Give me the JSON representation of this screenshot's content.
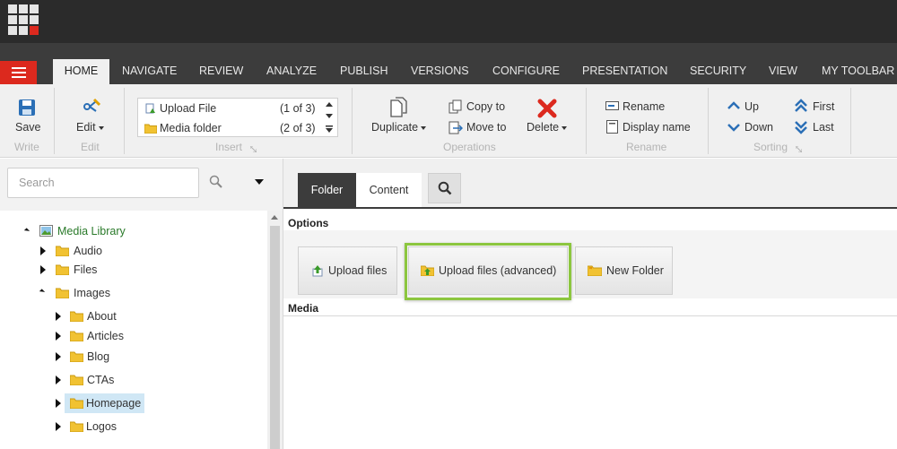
{
  "nav": {
    "tabs": [
      "HOME",
      "NAVIGATE",
      "REVIEW",
      "ANALYZE",
      "PUBLISH",
      "VERSIONS",
      "CONFIGURE",
      "PRESENTATION",
      "SECURITY",
      "VIEW",
      "MY TOOLBAR"
    ],
    "active_tab": "HOME"
  },
  "ribbon": {
    "write": {
      "save_label": "Save",
      "group_label": "Write"
    },
    "edit": {
      "edit_label": "Edit",
      "group_label": "Edit"
    },
    "insert": {
      "items": [
        {
          "label": "Upload File",
          "count": "(1 of 3)"
        },
        {
          "label": "Media folder",
          "count": "(2 of 3)"
        }
      ],
      "group_label": "Insert"
    },
    "operations": {
      "duplicate_label": "Duplicate",
      "copy_to_label": "Copy to",
      "move_to_label": "Move to",
      "delete_label": "Delete",
      "group_label": "Operations"
    },
    "rename": {
      "rename_label": "Rename",
      "display_name_label": "Display name",
      "group_label": "Rename"
    },
    "sorting": {
      "up_label": "Up",
      "down_label": "Down",
      "first_label": "First",
      "last_label": "Last",
      "group_label": "Sorting"
    }
  },
  "search": {
    "placeholder": "Search"
  },
  "tree": {
    "root": "Media Library",
    "children": [
      "Audio",
      "Files",
      "Images"
    ],
    "image_children": [
      "About",
      "Articles",
      "Blog",
      "CTAs",
      "Homepage",
      "Logos"
    ],
    "selected": "Homepage"
  },
  "panel": {
    "tabs": {
      "folder": "Folder",
      "content": "Content"
    },
    "options_title": "Options",
    "media_title": "Media",
    "buttons": {
      "upload_files": "Upload files",
      "upload_files_advanced": "Upload files (advanced)",
      "new_folder": "New Folder"
    }
  },
  "colors": {
    "accent_red": "#dc291e",
    "highlight_green": "#8cc63f",
    "nav_dark": "#3c3c3c",
    "top_dark": "#2b2b2b",
    "selection_blue": "#d0e7f5"
  }
}
